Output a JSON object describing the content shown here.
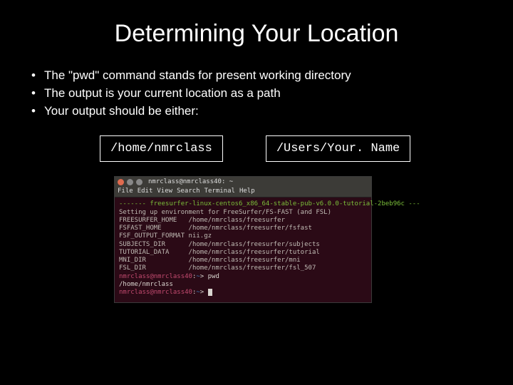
{
  "title": "Determining Your Location",
  "bullets": [
    "The \"pwd\" command stands for present working directory",
    "The output is your current location as a path",
    "Your output should be either:"
  ],
  "paths": {
    "left": "/home/nmrclass",
    "right": "/Users/Your. Name"
  },
  "terminal": {
    "window_title": "nmrclass@nmrclass40: ~",
    "menu": [
      "File",
      "Edit",
      "View",
      "Search",
      "Terminal",
      "Help"
    ],
    "banner": "------- freesurfer-linux-centos6_x86_64-stable-pub-v6.0.0-tutorial-2beb96c ---",
    "env_header": "Setting up environment for FreeSurfer/FS-FAST (and FSL)",
    "env": [
      {
        "k": "FREESURFER_HOME",
        "v": "/home/nmrclass/freesurfer"
      },
      {
        "k": "FSFAST_HOME",
        "v": "/home/nmrclass/freesurfer/fsfast"
      },
      {
        "k": "FSF_OUTPUT_FORMAT",
        "v": "nii.gz"
      },
      {
        "k": "SUBJECTS_DIR",
        "v": "/home/nmrclass/freesurfer/subjects"
      },
      {
        "k": "TUTORIAL_DATA",
        "v": "/home/nmrclass/freesurfer/tutorial"
      },
      {
        "k": "MNI_DIR",
        "v": "/home/nmrclass/freesurfer/mni"
      },
      {
        "k": "FSL_DIR",
        "v": "/home/nmrclass/freesurfer/fsl_507"
      }
    ],
    "prompt": {
      "user": "nmrclass@nmrclass40",
      "sep": ":",
      "path": "~"
    },
    "cmd1": "pwd",
    "out1": "/home/nmrclass",
    "cmd2": ""
  }
}
